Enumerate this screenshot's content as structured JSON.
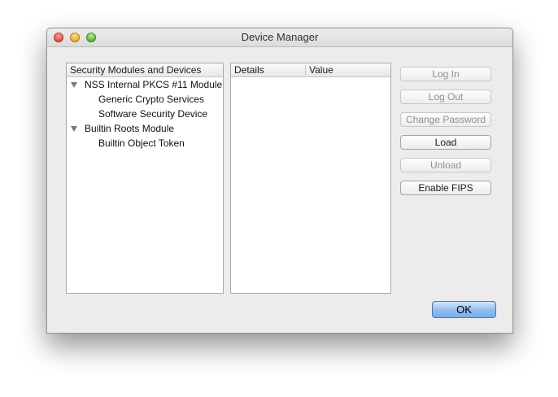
{
  "window": {
    "title": "Device Manager"
  },
  "tree": {
    "header": "Security Modules and Devices",
    "items": [
      {
        "label": "NSS Internal PKCS #11 Module"
      },
      {
        "label": "Generic Crypto Services"
      },
      {
        "label": "Software Security Device"
      },
      {
        "label": "Builtin Roots Module"
      },
      {
        "label": "Builtin Object Token"
      }
    ]
  },
  "details": {
    "col_details": "Details",
    "col_value": "Value"
  },
  "buttons": {
    "log_in": "Log In",
    "log_out": "Log Out",
    "change_password": "Change Password",
    "load": "Load",
    "unload": "Unload",
    "enable_fips": "Enable FIPS",
    "ok": "OK"
  }
}
